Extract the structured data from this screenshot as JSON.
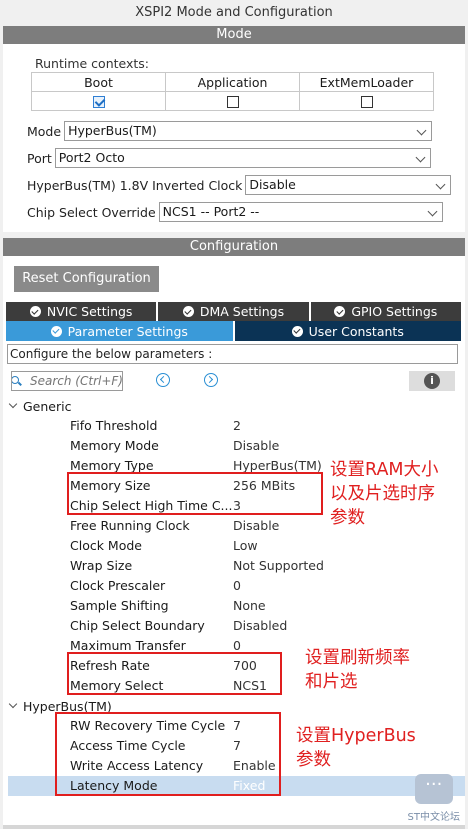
{
  "window": {
    "title": "XSPI2 Mode and Configuration"
  },
  "mode": {
    "section_title": "Mode",
    "runtime_label": "Runtime contexts:",
    "contexts": [
      {
        "label": "Boot",
        "checked": true
      },
      {
        "label": "Application",
        "checked": false
      },
      {
        "label": "ExtMemLoader",
        "checked": false
      }
    ],
    "fields": {
      "mode": {
        "label": "Mode",
        "value": "HyperBus(TM)"
      },
      "port": {
        "label": "Port",
        "value": "Port2 Octo"
      },
      "inverted_clock": {
        "label": "HyperBus(TM) 1.8V Inverted Clock",
        "value": "Disable"
      },
      "chip_select_override": {
        "label": "Chip Select Override",
        "value": "NCS1 -- Port2 --"
      }
    }
  },
  "configuration": {
    "section_title": "Configuration",
    "reset_label": "Reset Configuration",
    "tabs": {
      "nvic": "NVIC Settings",
      "dma": "DMA Settings",
      "gpio": "GPIO Settings",
      "parameter": "Parameter Settings",
      "user_constants": "User Constants"
    },
    "hint": "Configure the below parameters :",
    "search_placeholder": "Search (Ctrl+F)",
    "info_glyph": "i",
    "groups": {
      "generic": {
        "label": "Generic",
        "params": [
          {
            "name": "Fifo Threshold",
            "value": "2"
          },
          {
            "name": "Memory Mode",
            "value": "Disable"
          },
          {
            "name": "Memory Type",
            "value": "HyperBus(TM)"
          },
          {
            "name": "Memory Size",
            "value": "256 MBits"
          },
          {
            "name": "Chip Select High Time C...",
            "value": "3"
          },
          {
            "name": "Free Running Clock",
            "value": "Disable"
          },
          {
            "name": "Clock Mode",
            "value": "Low"
          },
          {
            "name": "Wrap Size",
            "value": "Not Supported"
          },
          {
            "name": "Clock Prescaler",
            "value": "0"
          },
          {
            "name": "Sample Shifting",
            "value": "None"
          },
          {
            "name": "Chip Select Boundary",
            "value": "Disabled"
          },
          {
            "name": "Maximum Transfer",
            "value": "0"
          },
          {
            "name": "Refresh Rate",
            "value": "700"
          },
          {
            "name": "Memory Select",
            "value": "NCS1"
          }
        ]
      },
      "hyperbus": {
        "label": "HyperBus(TM)",
        "params": [
          {
            "name": "RW Recovery Time Cycle",
            "value": "7"
          },
          {
            "name": "Access Time Cycle",
            "value": "7"
          },
          {
            "name": "Write Access Latency",
            "value": "Enable"
          },
          {
            "name": "Latency Mode",
            "value": "Fixed"
          }
        ]
      }
    }
  },
  "annotations": {
    "ram_size_line1": "设置RAM大小",
    "ram_size_line2": "以及片选时序",
    "ram_size_line3": "参数",
    "refresh_line1": "设置刷新频率",
    "refresh_line2": "和片选",
    "hyperbus_line1": "设置HyperBus",
    "hyperbus_line2": "参数",
    "color": "#e02020"
  },
  "watermark": {
    "text": "ST中文论坛"
  }
}
